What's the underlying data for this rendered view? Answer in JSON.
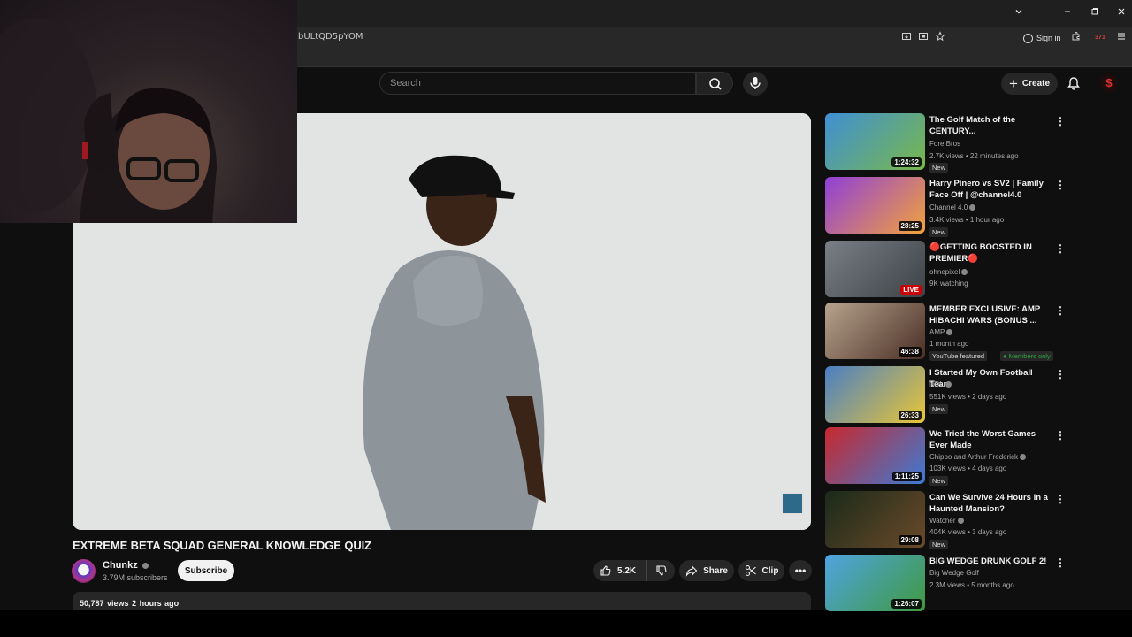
{
  "browser": {
    "url": "bULtQD5pYOM",
    "sign_in": "Sign in",
    "badge_count": "371"
  },
  "header": {
    "search_placeholder": "Search",
    "create_label": "Create"
  },
  "video": {
    "title": "EXTREME BETA SQUAD GENERAL KNOWLEDGE QUIZ",
    "channel": "Chunkz",
    "subscribers": "3.79M subscribers",
    "subscribe_label": "Subscribe",
    "likes": "5.2K",
    "share_label": "Share",
    "clip_label": "Clip",
    "views": "50,787 views",
    "age": "2 hours ago"
  },
  "recommendations": [
    {
      "title": "The Golf Match of the CENTURY...",
      "channel": "Fore Bros",
      "meta": "2.7K views • 22 minutes ago",
      "duration": "1:24:32",
      "badge": "New",
      "thumb_colors": [
        "#3f8fd4",
        "#79b84a"
      ],
      "verified": false
    },
    {
      "title": "Harry Pinero vs SV2 | Family Face Off | @channel4.0",
      "channel": "Channel 4.0",
      "meta": "3.4K views • 1 hour ago",
      "duration": "28:25",
      "badge": "New",
      "thumb_colors": [
        "#8f3fd8",
        "#f2a23b"
      ],
      "verified": true
    },
    {
      "title": "🔴GETTING BOOSTED IN PREMIER🔴",
      "channel": "ohnepixel",
      "meta": "9K watching",
      "duration": "LIVE",
      "badge": "",
      "thumb_colors": [
        "#7a7f86",
        "#3d4246"
      ],
      "verified": true
    },
    {
      "title": "MEMBER EXCLUSIVE: AMP HIBACHI WARS (BONUS ...",
      "channel": "AMP",
      "meta": "1 month ago",
      "duration": "46:38",
      "badge": "YouTube featured",
      "badge2": "Members only",
      "thumb_colors": [
        "#b7a38d",
        "#4a2f25"
      ],
      "verified": true
    },
    {
      "title": "I Started My Own Football Team",
      "channel": "NDL",
      "meta": "551K views • 2 days ago",
      "duration": "26:33",
      "badge": "New",
      "thumb_colors": [
        "#4a7fc4",
        "#e9c636"
      ],
      "verified": true
    },
    {
      "title": "We Tried the Worst Games Ever Made",
      "channel": "Chippo and Arthur Frederick",
      "meta": "103K views • 4 days ago",
      "duration": "1:11:25",
      "badge": "New",
      "thumb_colors": [
        "#c8282e",
        "#3c7bd4"
      ],
      "verified": true
    },
    {
      "title": "Can We Survive 24 Hours in a Haunted Mansion?",
      "channel": "Watcher",
      "meta": "404K views • 3 days ago",
      "duration": "29:08",
      "badge": "New",
      "thumb_colors": [
        "#1a2a1a",
        "#6b4a2a"
      ],
      "verified": true
    },
    {
      "title": "BIG WEDGE DRUNK GOLF 2!",
      "channel": "Big Wedge Golf",
      "meta": "2.3M views • 5 months ago",
      "duration": "1:26:07",
      "badge": "",
      "thumb_colors": [
        "#4fa3e0",
        "#3f9a40"
      ],
      "verified": false
    }
  ],
  "colors": {
    "background": "#0f0f0f",
    "accent": "#cc0000",
    "pill": "#272727"
  }
}
